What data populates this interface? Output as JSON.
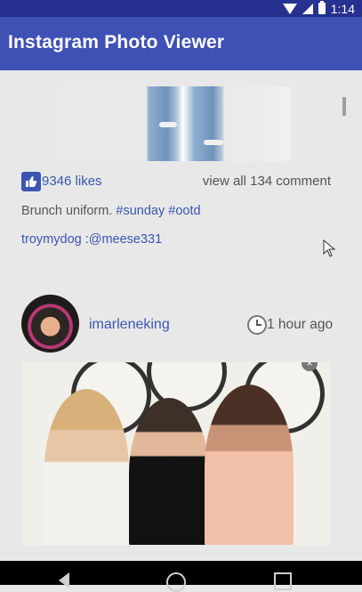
{
  "status_bar": {
    "time": "1:14",
    "icons": [
      "wifi-icon",
      "signal-icon",
      "battery-icon"
    ]
  },
  "app_bar": {
    "title": "Instagram Photo Viewer"
  },
  "feed": {
    "post1": {
      "likes": "9346 likes",
      "comments_link": "view all 134 comment",
      "caption": {
        "text": "Brunch uniform.",
        "hashtags": [
          "#sunday",
          "#ootd"
        ]
      },
      "comment": "troymydog :@meese331"
    },
    "post2": {
      "username": "imarleneking",
      "time_ago": "1 hour ago"
    }
  },
  "nav_bar": {
    "buttons": [
      "back-icon",
      "home-icon",
      "recents-icon"
    ]
  },
  "colors": {
    "status_bar": "#27318f",
    "app_bar": "#3f51b5",
    "accent": "#3a56b0",
    "background": "#e8e8e8",
    "text_secondary": "#555555"
  }
}
